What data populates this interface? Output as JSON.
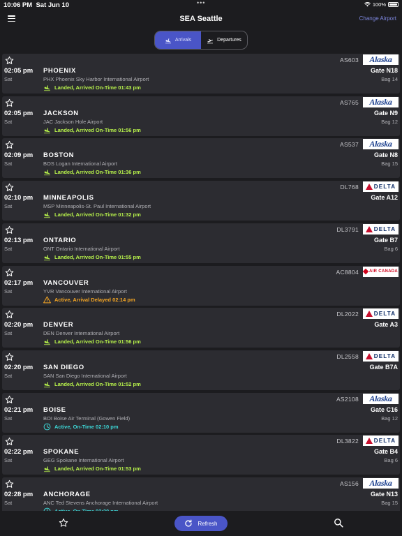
{
  "status_bar": {
    "time": "10:06 PM",
    "date": "Sat Jun 10",
    "battery": "100%"
  },
  "header": {
    "title": "SEA Seattle",
    "change_airport": "Change Airport",
    "menu_icon": "hamburger-menu-icon"
  },
  "segment": {
    "arrivals_label": "Arrivals",
    "departures_label": "Departures",
    "selected": "Arrivals"
  },
  "colors": {
    "accent": "#4a55c7",
    "landed": "#b8f34b",
    "delayed": "#f5a623",
    "active": "#3dd6d6",
    "card": "#2c2c31",
    "background": "#1c1c1f"
  },
  "flights": [
    {
      "flight": "AS603",
      "airline": "alaska",
      "time": "02:05 pm",
      "day": "Sat",
      "city": "PHOENIX",
      "airport": "PHX Phoenix Sky Harbor International Airport",
      "status": "Landed, Arrived On-Time 01:43 pm",
      "status_kind": "landed",
      "gate": "Gate N18",
      "bag": "Bag 14"
    },
    {
      "flight": "AS765",
      "airline": "alaska",
      "time": "02:05 pm",
      "day": "Sat",
      "city": "JACKSON",
      "airport": "JAC Jackson Hole Airport",
      "status": "Landed, Arrived On-Time 01:56 pm",
      "status_kind": "landed",
      "gate": "Gate N9",
      "bag": "Bag 12"
    },
    {
      "flight": "AS537",
      "airline": "alaska",
      "time": "02:09 pm",
      "day": "Sat",
      "city": "BOSTON",
      "airport": "BOS Logan International Airport",
      "status": "Landed, Arrived On-Time 01:36 pm",
      "status_kind": "landed",
      "gate": "Gate N8",
      "bag": "Bag 15"
    },
    {
      "flight": "DL768",
      "airline": "delta",
      "time": "02:10 pm",
      "day": "Sat",
      "city": "MINNEAPOLIS",
      "airport": "MSP Minneapolis-St. Paul International Airport",
      "status": "Landed, Arrived On-Time 01:32 pm",
      "status_kind": "landed",
      "gate": "Gate A12",
      "bag": ""
    },
    {
      "flight": "DL3791",
      "airline": "delta",
      "time": "02:13 pm",
      "day": "Sat",
      "city": "ONTARIO",
      "airport": "ONT Ontario International Airport",
      "status": "Landed, Arrived On-Time 01:55 pm",
      "status_kind": "landed",
      "gate": "Gate B7",
      "bag": "Bag 6"
    },
    {
      "flight": "AC8804",
      "airline": "aircanada",
      "time": "02:17 pm",
      "day": "Sat",
      "city": "VANCOUVER",
      "airport": "YVR Vancouver International Airport",
      "status": "Active, Arrival Delayed 02:14 pm",
      "status_kind": "delayed",
      "gate": "",
      "bag": ""
    },
    {
      "flight": "DL2022",
      "airline": "delta",
      "time": "02:20 pm",
      "day": "Sat",
      "city": "DENVER",
      "airport": "DEN Denver International Airport",
      "status": "Landed, Arrived On-Time 01:56 pm",
      "status_kind": "landed",
      "gate": "Gate A3",
      "bag": ""
    },
    {
      "flight": "DL2558",
      "airline": "delta",
      "time": "02:20 pm",
      "day": "Sat",
      "city": "SAN DIEGO",
      "airport": "SAN San Diego International Airport",
      "status": "Landed, Arrived On-Time 01:52 pm",
      "status_kind": "landed",
      "gate": "Gate B7A",
      "bag": ""
    },
    {
      "flight": "AS2108",
      "airline": "alaska",
      "time": "02:21 pm",
      "day": "Sat",
      "city": "BOISE",
      "airport": "BOI Boise Air Terminal (Gowen Field)",
      "status": "Active, On-Time 02:10 pm",
      "status_kind": "active",
      "gate": "Gate C16",
      "bag": "Bag 12"
    },
    {
      "flight": "DL3822",
      "airline": "delta",
      "time": "02:22 pm",
      "day": "Sat",
      "city": "SPOKANE",
      "airport": "GEG Spokane International Airport",
      "status": "Landed, Arrived On-Time 01:53 pm",
      "status_kind": "landed",
      "gate": "Gate B4",
      "bag": "Bag 6"
    },
    {
      "flight": "AS156",
      "airline": "alaska",
      "time": "02:28 pm",
      "day": "Sat",
      "city": "ANCHORAGE",
      "airport": "ANC Ted Stevens Anchorage International Airport",
      "status": "Active, On-Time 02:20 pm",
      "status_kind": "active",
      "gate": "Gate N13",
      "bag": "Bag 15"
    }
  ],
  "logos": {
    "alaska": "Alaska",
    "delta": "DELTA",
    "aircanada": "AIR CANADA"
  },
  "tab_bar": {
    "refresh_label": "Refresh"
  }
}
